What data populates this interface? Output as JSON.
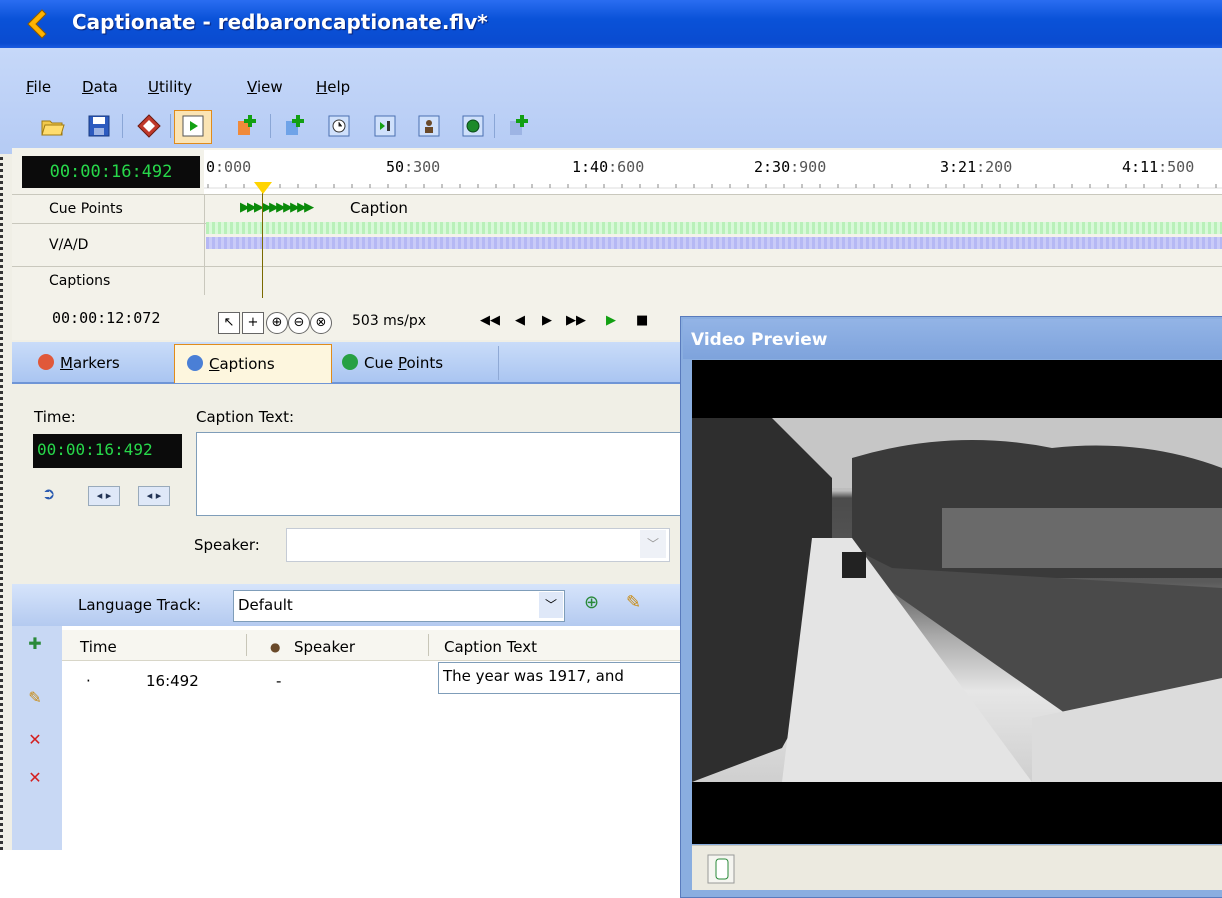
{
  "window": {
    "title": "Captionate - redbaroncaptionate.flv*"
  },
  "menu": [
    {
      "label": "File",
      "key": "F"
    },
    {
      "label": "Data",
      "key": "D"
    },
    {
      "label": "Utility",
      "key": "U"
    },
    {
      "label": "View",
      "key": "V"
    },
    {
      "label": "Help",
      "key": "H"
    }
  ],
  "timeline": {
    "current_time": "00:00:16:492",
    "ruler_ticks": [
      {
        "main": "0",
        "sub": ":000"
      },
      {
        "main": "50",
        "sub": ":300"
      },
      {
        "main": "1:40",
        "sub": ":600"
      },
      {
        "main": "2:30",
        "sub": ":900"
      },
      {
        "main": "3:21",
        "sub": ":200"
      },
      {
        "main": "4:11",
        "sub": ":500"
      }
    ],
    "rows": [
      "Cue Points",
      "V/A/D",
      "Captions"
    ],
    "cue_label": "Caption",
    "cursor_time": "00:00:12:072",
    "zoom": "503 ms/px"
  },
  "tabs": [
    {
      "label": "Markers",
      "key": "M"
    },
    {
      "label": "Captions",
      "key": "C",
      "active": true
    },
    {
      "label": "Cue Points",
      "key": "P"
    }
  ],
  "caption_edit": {
    "time_label": "Time:",
    "time_value": "00:00:16:492",
    "caption_label": "Caption Text:",
    "caption_value": "",
    "speaker_label": "Speaker:",
    "speaker_value": ""
  },
  "language_track": {
    "label": "Language Track:",
    "value": "Default"
  },
  "grid": {
    "headers": [
      "Time",
      "Speaker",
      "Caption Text"
    ],
    "rows": [
      {
        "marker": "·",
        "time": "16:492",
        "speaker": "-",
        "caption": "The year was 1917, and"
      }
    ]
  },
  "video_preview": {
    "title": "Video Preview"
  },
  "colors": {
    "title_bar": "#0a52d8",
    "timecode_bg": "#0b0b0b",
    "timecode_fg": "#27d84a",
    "active_tab_border": "#e08b1a"
  }
}
